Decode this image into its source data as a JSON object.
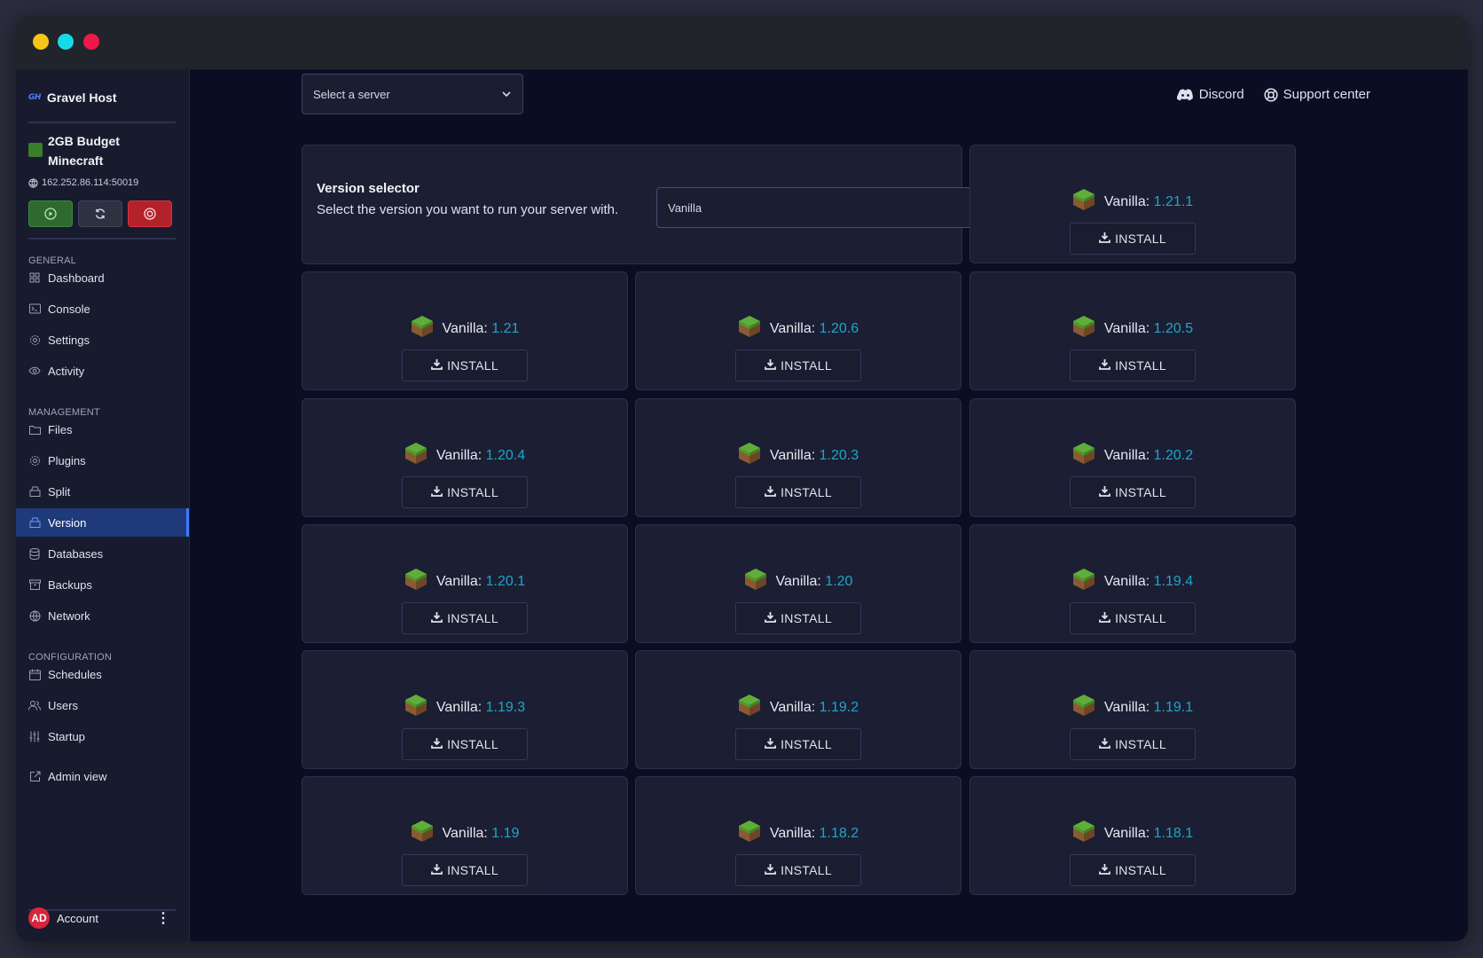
{
  "brand": {
    "logo": "GH",
    "name": "Gravel Host"
  },
  "server": {
    "name": "2GB Budget Minecraft",
    "ip": "162.252.86.114:50019"
  },
  "sidebar": {
    "sections": [
      {
        "title": "GENERAL",
        "items": [
          {
            "label": "Dashboard",
            "icon": "grid-icon"
          },
          {
            "label": "Console",
            "icon": "terminal-icon"
          },
          {
            "label": "Settings",
            "icon": "gear-icon"
          },
          {
            "label": "Activity",
            "icon": "eye-icon"
          }
        ]
      },
      {
        "title": "MANAGEMENT",
        "items": [
          {
            "label": "Files",
            "icon": "folder-icon"
          },
          {
            "label": "Plugins",
            "icon": "gear-icon"
          },
          {
            "label": "Split",
            "icon": "box-icon"
          },
          {
            "label": "Version",
            "icon": "box-icon",
            "active": true
          },
          {
            "label": "Databases",
            "icon": "database-icon"
          },
          {
            "label": "Backups",
            "icon": "archive-icon"
          },
          {
            "label": "Network",
            "icon": "globe-icon"
          }
        ]
      },
      {
        "title": "CONFIGURATION",
        "items": [
          {
            "label": "Schedules",
            "icon": "calendar-icon"
          },
          {
            "label": "Users",
            "icon": "users-icon"
          },
          {
            "label": "Startup",
            "icon": "sliders-icon"
          }
        ]
      }
    ],
    "admin_view": "Admin view",
    "account": {
      "initials": "AD",
      "label": "Account"
    }
  },
  "top": {
    "server_select_placeholder": "Select a server",
    "discord": "Discord",
    "support": "Support center"
  },
  "version_selector": {
    "title": "Version selector",
    "description": "Select the version you want to run your server with.",
    "selected": "Vanilla"
  },
  "versions": [
    {
      "prefix": "Vanilla:",
      "version": "1.21.1"
    },
    {
      "prefix": "Vanilla:",
      "version": "1.21"
    },
    {
      "prefix": "Vanilla:",
      "version": "1.20.6"
    },
    {
      "prefix": "Vanilla:",
      "version": "1.20.5"
    },
    {
      "prefix": "Vanilla:",
      "version": "1.20.4"
    },
    {
      "prefix": "Vanilla:",
      "version": "1.20.3"
    },
    {
      "prefix": "Vanilla:",
      "version": "1.20.2"
    },
    {
      "prefix": "Vanilla:",
      "version": "1.20.1"
    },
    {
      "prefix": "Vanilla:",
      "version": "1.20"
    },
    {
      "prefix": "Vanilla:",
      "version": "1.19.4"
    },
    {
      "prefix": "Vanilla:",
      "version": "1.19.3"
    },
    {
      "prefix": "Vanilla:",
      "version": "1.19.2"
    },
    {
      "prefix": "Vanilla:",
      "version": "1.19.1"
    },
    {
      "prefix": "Vanilla:",
      "version": "1.19"
    },
    {
      "prefix": "Vanilla:",
      "version": "1.18.2"
    },
    {
      "prefix": "Vanilla:",
      "version": "1.18.1"
    }
  ],
  "install_label": "INSTALL",
  "colors": {
    "accent": "#1fa6c9",
    "active_nav": "#1e3a7a",
    "danger": "#b3212b",
    "success": "#2e6a30"
  }
}
